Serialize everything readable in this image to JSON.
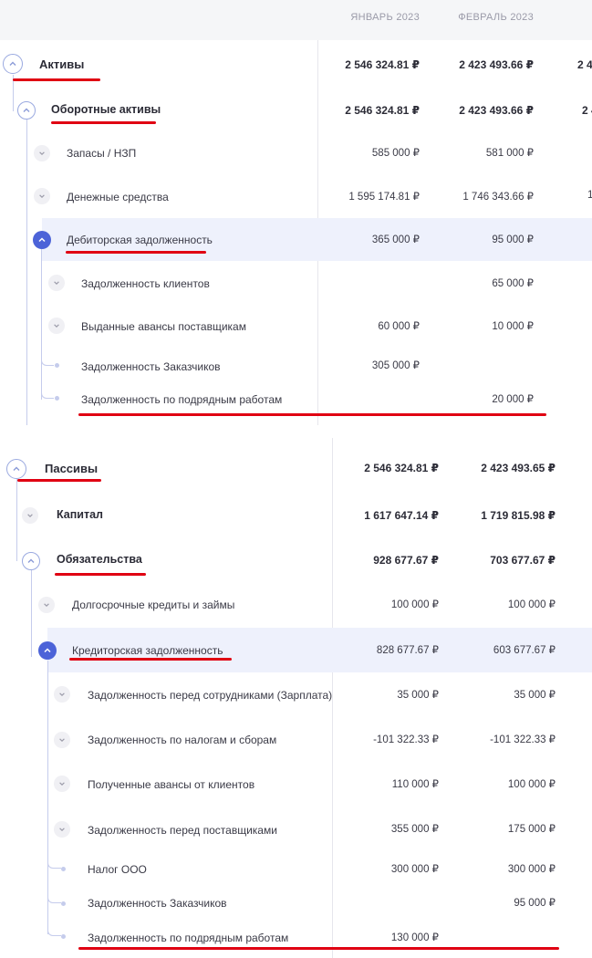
{
  "colors": {
    "accent": "#4c63d8",
    "annotation": "#e00012",
    "highlight_row": "#eef1fc"
  },
  "assets": {
    "columns": [
      "ЯНВАРЬ 2023",
      "ФЕВРАЛЬ 2023"
    ],
    "overflow_value_root": "2 4",
    "overflow_value_sub": "2 4",
    "overflow_value_cash": "1",
    "rows": [
      {
        "label": "Активы",
        "jan": "2 546 324.81 ₽",
        "feb": "2 423 493.66 ₽"
      },
      {
        "label": "Оборотные активы",
        "jan": "2 546 324.81 ₽",
        "feb": "2 423 493.66 ₽"
      },
      {
        "label": "Запасы / НЗП",
        "jan": "585 000 ₽",
        "feb": "581 000 ₽"
      },
      {
        "label": "Денежные средства",
        "jan": "1 595 174.81 ₽",
        "feb": "1 746 343.66 ₽"
      },
      {
        "label": "Дебиторская задолженность",
        "jan": "365 000 ₽",
        "feb": "95 000 ₽"
      },
      {
        "label": "Задолженность клиентов",
        "jan": "",
        "feb": "65 000 ₽"
      },
      {
        "label": "Выданные авансы поставщикам",
        "jan": "60 000 ₽",
        "feb": "10 000 ₽"
      },
      {
        "label": "Задолженность Заказчиков",
        "jan": "305 000 ₽",
        "feb": ""
      },
      {
        "label": "Задолженность по подрядным работам",
        "jan": "",
        "feb": "20 000 ₽"
      }
    ]
  },
  "liabilities": {
    "rows": [
      {
        "label": "Пассивы",
        "jan": "2 546 324.81 ₽",
        "feb": "2 423 493.65 ₽"
      },
      {
        "label": "Капитал",
        "jan": "1 617 647.14 ₽",
        "feb": "1 719 815.98 ₽"
      },
      {
        "label": "Обязательства",
        "jan": "928 677.67 ₽",
        "feb": "703 677.67 ₽"
      },
      {
        "label": "Долгосрочные кредиты и займы",
        "jan": "100 000 ₽",
        "feb": "100 000 ₽"
      },
      {
        "label": "Кредиторская задолженность",
        "jan": "828 677.67 ₽",
        "feb": "603 677.67 ₽"
      },
      {
        "label": "Задолженность перед сотрудниками (Зарплата)",
        "jan": "35 000 ₽",
        "feb": "35 000 ₽"
      },
      {
        "label": "Задолженность по налогам и сборам",
        "jan": "-101 322.33 ₽",
        "feb": "-101 322.33 ₽"
      },
      {
        "label": "Полученные авансы от клиентов",
        "jan": "110 000 ₽",
        "feb": "100 000 ₽"
      },
      {
        "label": "Задолженность перед поставщиками",
        "jan": "355 000 ₽",
        "feb": "175 000 ₽"
      },
      {
        "label": "Налог ООО",
        "jan": "300 000 ₽",
        "feb": "300 000 ₽"
      },
      {
        "label": "Задолженность Заказчиков",
        "jan": "",
        "feb": "95 000 ₽"
      },
      {
        "label": "Задолженность по подрядным работам",
        "jan": "130 000 ₽",
        "feb": ""
      }
    ]
  }
}
